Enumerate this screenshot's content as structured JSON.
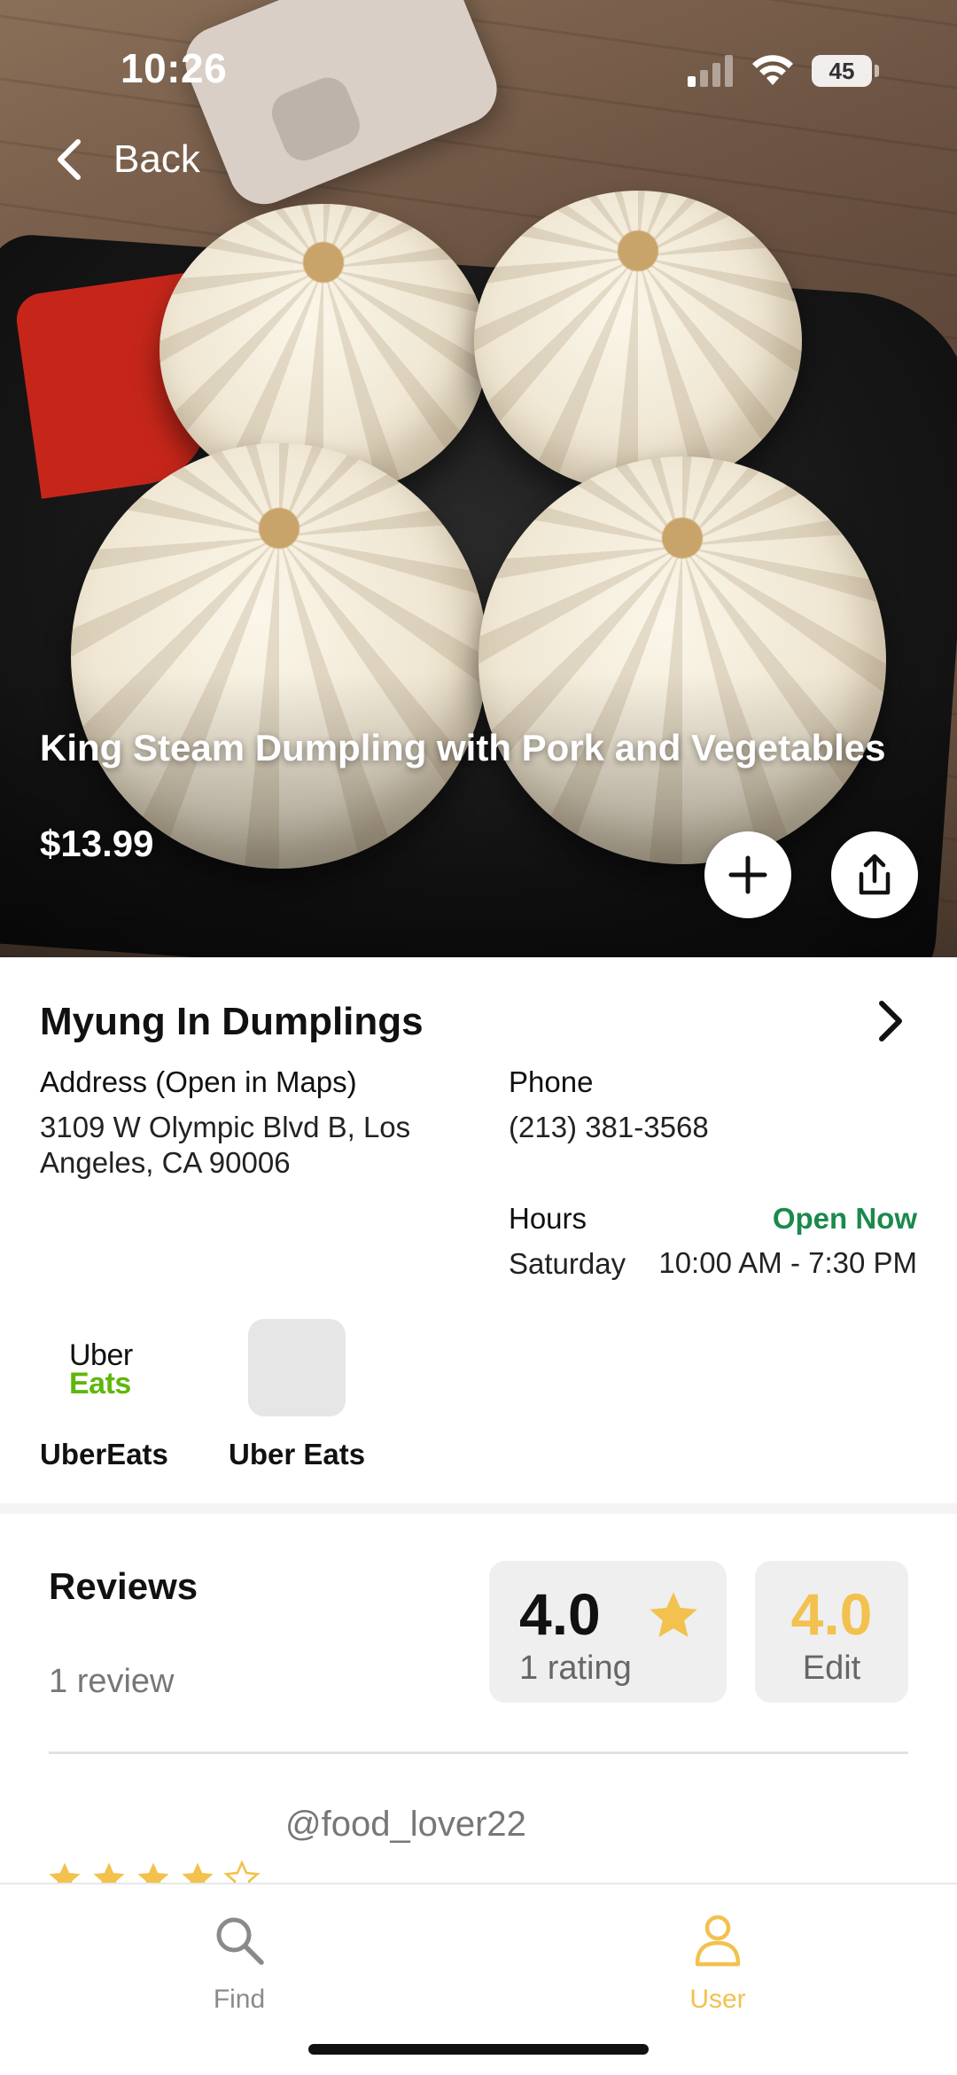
{
  "status_bar": {
    "time": "10:26",
    "battery": "45"
  },
  "nav": {
    "back_label": "Back"
  },
  "dish": {
    "title": "King Steam Dumpling with Pork and Vegetables",
    "price": "$13.99",
    "add_icon": "plus-icon",
    "share_icon": "share-icon"
  },
  "restaurant": {
    "name": "Myung In Dumplings",
    "address_label": "Address (Open in Maps)",
    "address": "3109 W Olympic Blvd B, Los Angeles, CA 90006",
    "phone_label": "Phone",
    "phone": "(213) 381-3568",
    "hours_label": "Hours",
    "open_status": "Open Now",
    "hours_day": "Saturday",
    "hours_time": "10:00 AM - 7:30 PM",
    "open_color": "#1a8a4c"
  },
  "delivery": {
    "services": [
      {
        "label": "UberEats",
        "logo_line1": "Uber",
        "logo_line2": "Eats"
      },
      {
        "label": "Uber Eats"
      }
    ]
  },
  "reviews": {
    "title": "Reviews",
    "review_count": "1 review",
    "average": "4.0",
    "rating_count": "1 rating",
    "my_rating": "4.0",
    "edit_label": "Edit",
    "items": [
      {
        "username": "@food_lover22",
        "stars": 4
      }
    ],
    "accent_color": "#f2c14e"
  },
  "tabbar": {
    "tabs": [
      {
        "label": "Find",
        "icon": "search-icon",
        "active": false
      },
      {
        "label": "User",
        "icon": "user-icon",
        "active": true
      }
    ]
  }
}
